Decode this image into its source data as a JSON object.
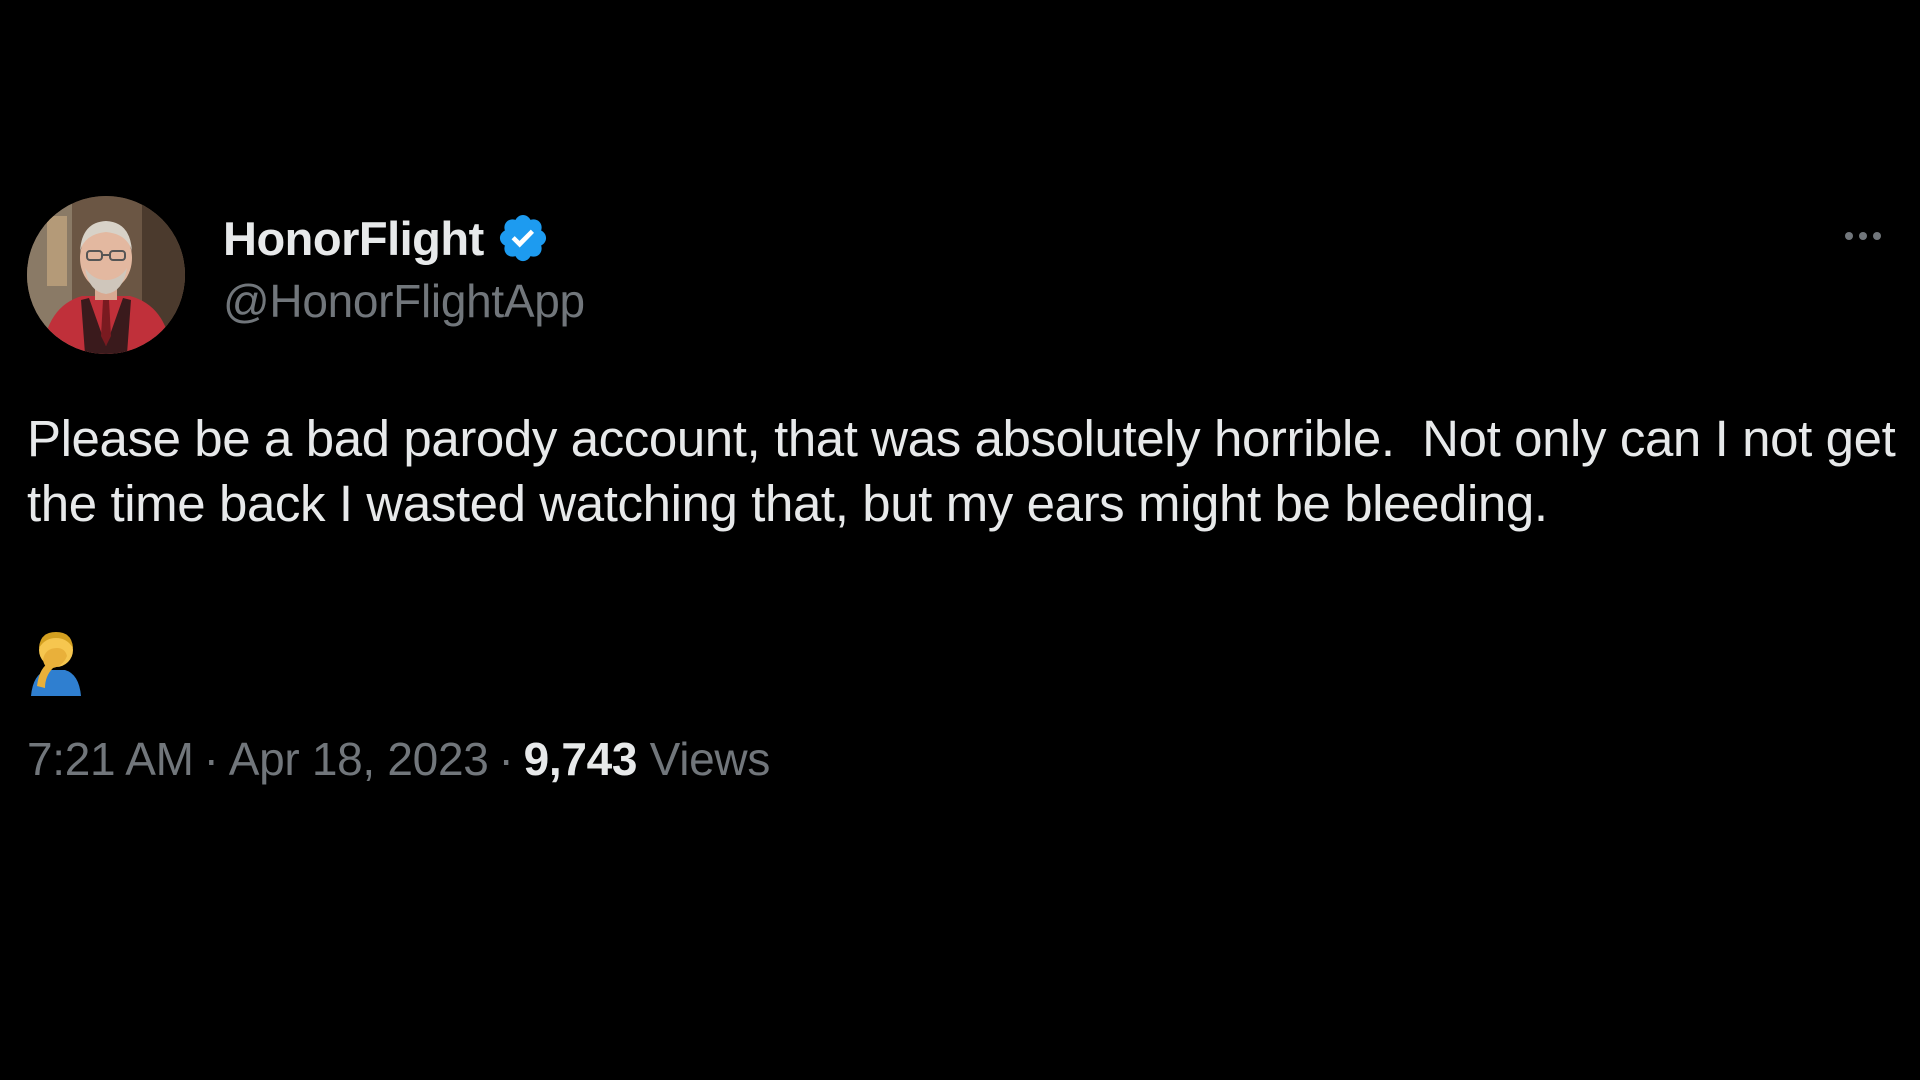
{
  "tweet": {
    "author": {
      "display_name": "HonorFlight",
      "handle": "@HonorFlightApp",
      "verified": true,
      "avatar_icon": "profile-photo"
    },
    "text": "Please be a bad parody account, that was absolutely horrible.  Not only can I not get the time back I wasted watching that, but my ears might be bleeding.",
    "emoji": "facepalm-icon",
    "meta": {
      "time": "7:21 AM",
      "separator": "·",
      "date": "Apr 18, 2023",
      "views_count": "9,743",
      "views_label": "Views"
    },
    "more_icon": "more-options-icon"
  },
  "colors": {
    "background": "#000000",
    "primary_text": "#e7e9ea",
    "secondary_text": "#71767b",
    "verified_blue": "#1d9bf0"
  }
}
